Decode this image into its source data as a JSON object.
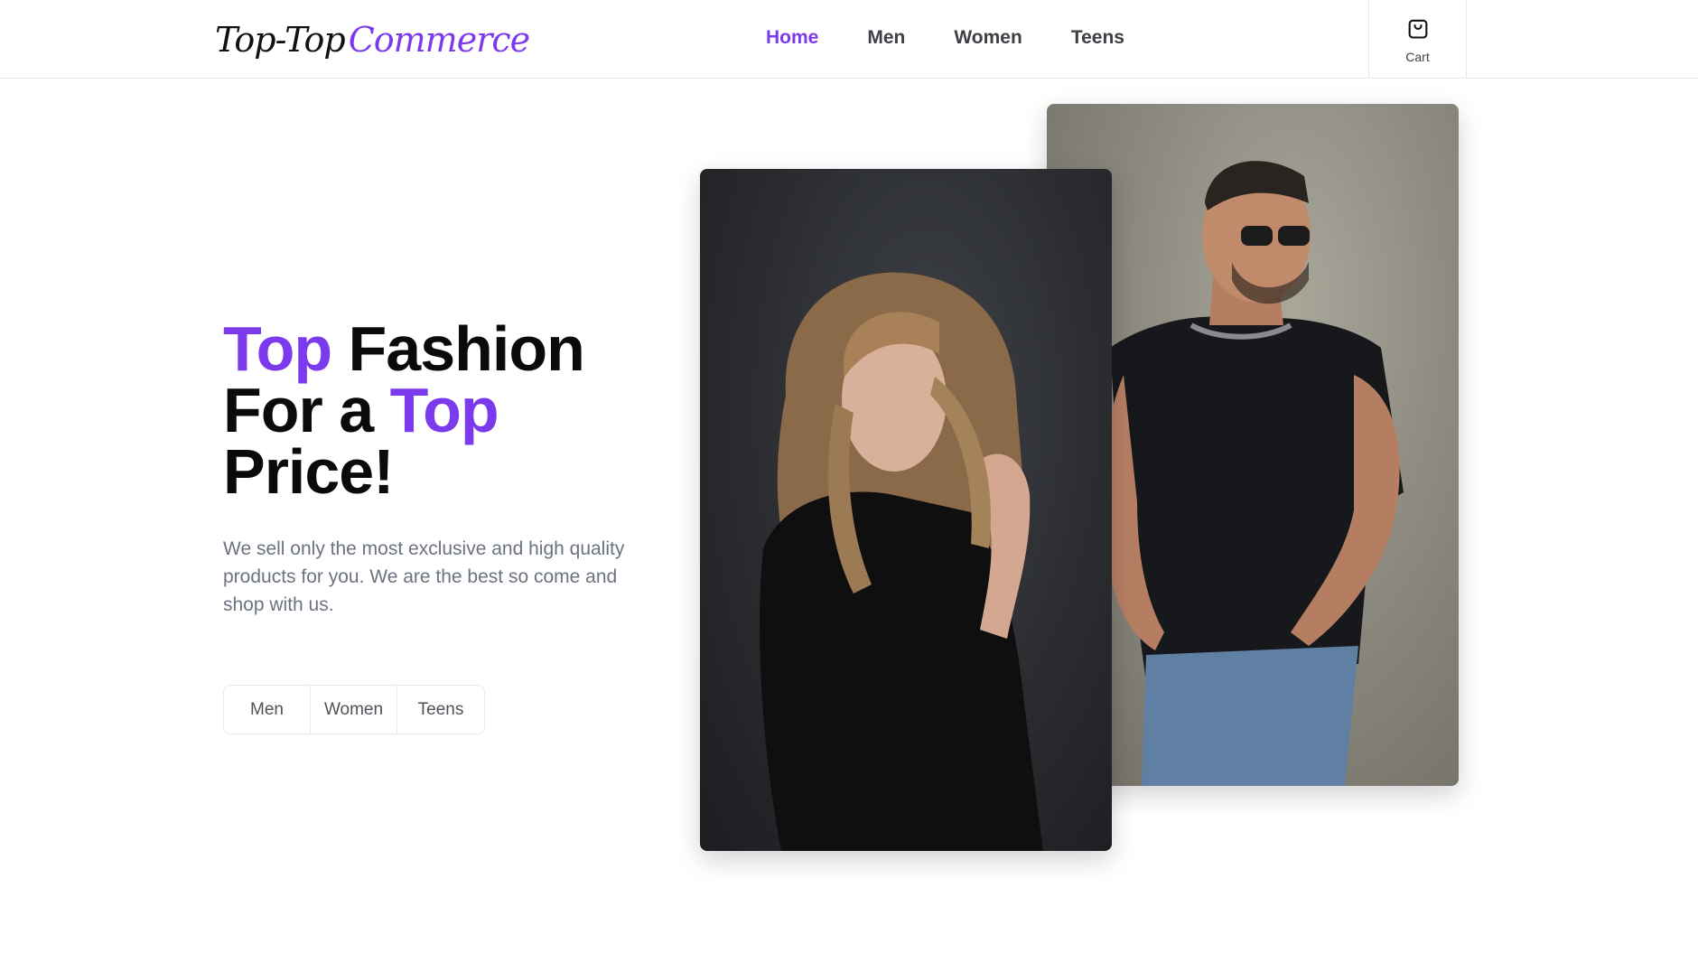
{
  "brand": {
    "part1": "Top-Top",
    "part2": "Commerce",
    "accent_color": "#7c3aed"
  },
  "nav": {
    "items": [
      {
        "label": "Home",
        "active": true
      },
      {
        "label": "Men",
        "active": false
      },
      {
        "label": "Women",
        "active": false
      },
      {
        "label": "Teens",
        "active": false
      }
    ]
  },
  "cart": {
    "label": "Cart",
    "icon": "shopping-bag-icon"
  },
  "hero": {
    "headline": {
      "w1": "Top",
      "w2": " Fashion",
      "w3": "For a ",
      "w4": "Top",
      "w5": "Price!"
    },
    "description": "We sell only the most exclusive and high quality products for you. We are the best so come and shop with us.",
    "category_buttons": [
      "Men",
      "Women",
      "Teens"
    ]
  },
  "images": {
    "man": "photo-man-sunglasses",
    "woman": "photo-woman-black-top"
  }
}
